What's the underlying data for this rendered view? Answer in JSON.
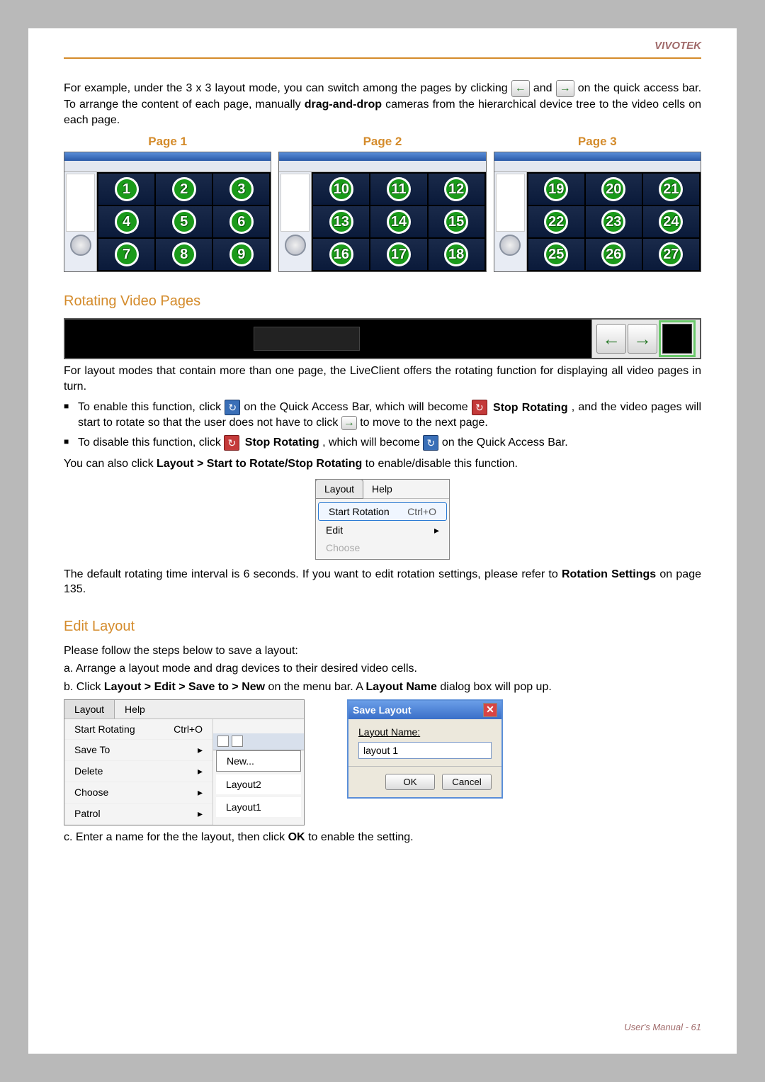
{
  "header": {
    "brand": "VIVOTEK"
  },
  "intro": {
    "para1_a": "For example, under the 3 x 3 layout mode, you can switch among the pages by clicking ",
    "para1_b": " and ",
    "para1_c": " on the quick access bar. To arrange the content of each page, manually ",
    "para1_bold": "drag-and-drop",
    "para1_d": " cameras from the hierarchical device tree to the video cells on each page."
  },
  "pages_row": {
    "labels": [
      "Page 1",
      "Page 2",
      "Page 3"
    ],
    "cells": [
      [
        1,
        2,
        3,
        4,
        5,
        6,
        7,
        8,
        9
      ],
      [
        10,
        11,
        12,
        13,
        14,
        15,
        16,
        17,
        18
      ],
      [
        19,
        20,
        21,
        22,
        23,
        24,
        25,
        26,
        27
      ]
    ]
  },
  "rotating": {
    "title": "Rotating Video Pages",
    "para": "For layout modes that contain more than one page, the LiveClient offers the rotating function for displaying all video pages in turn.",
    "bullet1_a": "To enable this function, click ",
    "bullet1_b": " on the Quick Access Bar, which will become ",
    "bullet1_bold1": "Stop Rotating",
    "bullet1_c": ", and the video pages will start to rotate so that the user does not have to click ",
    "bullet1_d": " to move to the next page.",
    "bullet2_a": "To disable this function, click ",
    "bullet2_bold": "Stop Rotating",
    "bullet2_b": ", which will become ",
    "bullet2_c": " on the Quick Access Bar.",
    "para2_a": "You can also click ",
    "para2_bold": "Layout > Start to Rotate/Stop Rotating",
    "para2_b": " to enable/disable this function.",
    "menu": {
      "layout": "Layout",
      "help": "Help",
      "start": "Start Rotation",
      "start_sc": "Ctrl+O",
      "edit": "Edit",
      "choose": "Choose"
    },
    "default_a": "The default rotating time interval is 6 seconds. If you want to edit rotation settings, please refer to ",
    "default_bold": "Rotation Settings",
    "default_b": " on page 135."
  },
  "edit": {
    "title": "Edit Layout",
    "lead": "Please follow the steps below to save a layout:",
    "step_a": "a. Arrange a layout mode and drag devices to their desired video cells.",
    "step_b_a": "b. Click ",
    "step_b_bold": "Layout > Edit > Save to > New",
    "step_b_b": " on the menu bar. A ",
    "step_b_bold2": "Layout Name",
    "step_b_c": " dialog box will pop up.",
    "menu2": {
      "layout": "Layout",
      "help": "Help",
      "start_rotating": "Start Rotating",
      "start_sc": "Ctrl+O",
      "save_to": "Save To",
      "delete": "Delete",
      "choose": "Choose",
      "patrol": "Patrol",
      "new": "New...",
      "l2": "Layout2",
      "l1": "Layout1"
    },
    "dialog": {
      "title": "Save Layout",
      "label": "Layout Name:",
      "value": "layout 1",
      "ok": "OK",
      "cancel": "Cancel"
    },
    "step_c_a": "c. Enter a name for the the layout, then click ",
    "step_c_bold": "OK",
    "step_c_b": " to enable the setting."
  },
  "footer": {
    "label": "User's Manual - 61"
  }
}
